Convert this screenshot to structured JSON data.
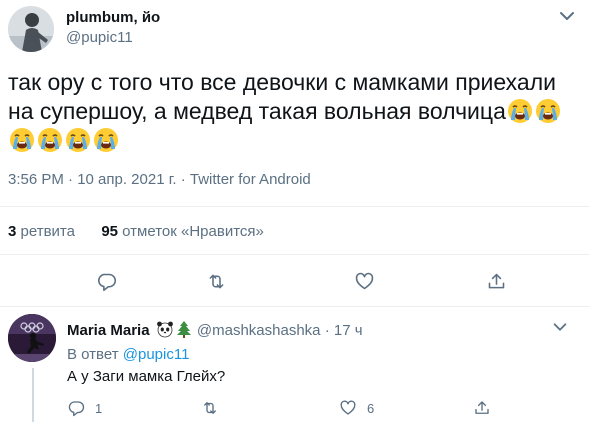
{
  "tweet": {
    "author_name": "plumbum, йо",
    "author_handle": "@pupic11",
    "text": "так ору с того что все девочки с мамками приехали на супершоу, а медвед такая вольная волчица",
    "emoji": "loudly-crying-face",
    "emoji_count": 6,
    "timestamp": "3:56 PM · 10 апр. 2021 г.",
    "source": "Twitter for Android",
    "retweets_count": "3",
    "retweets_label": "ретвита",
    "likes_count": "95",
    "likes_label": "отметок «Нравится»"
  },
  "actions": {
    "icons": [
      "reply-icon",
      "retweet-icon",
      "like-icon",
      "share-icon"
    ]
  },
  "reply": {
    "author_name": "Maria Maria",
    "author_emoji": [
      "panda-face",
      "evergreen-tree"
    ],
    "author_handle": "@mashkashashka",
    "time": "17 ч",
    "reply_to_prefix": "В ответ",
    "reply_to_handle": "@pupic11",
    "text": "А у Заги мамка Глейх?",
    "reply_count": "1",
    "retweet_count": "",
    "like_count": "6"
  },
  "colors": {
    "text": "#0f1419",
    "secondary": "#5b7083",
    "link": "#1b95e0",
    "divider": "#ebeef0"
  }
}
